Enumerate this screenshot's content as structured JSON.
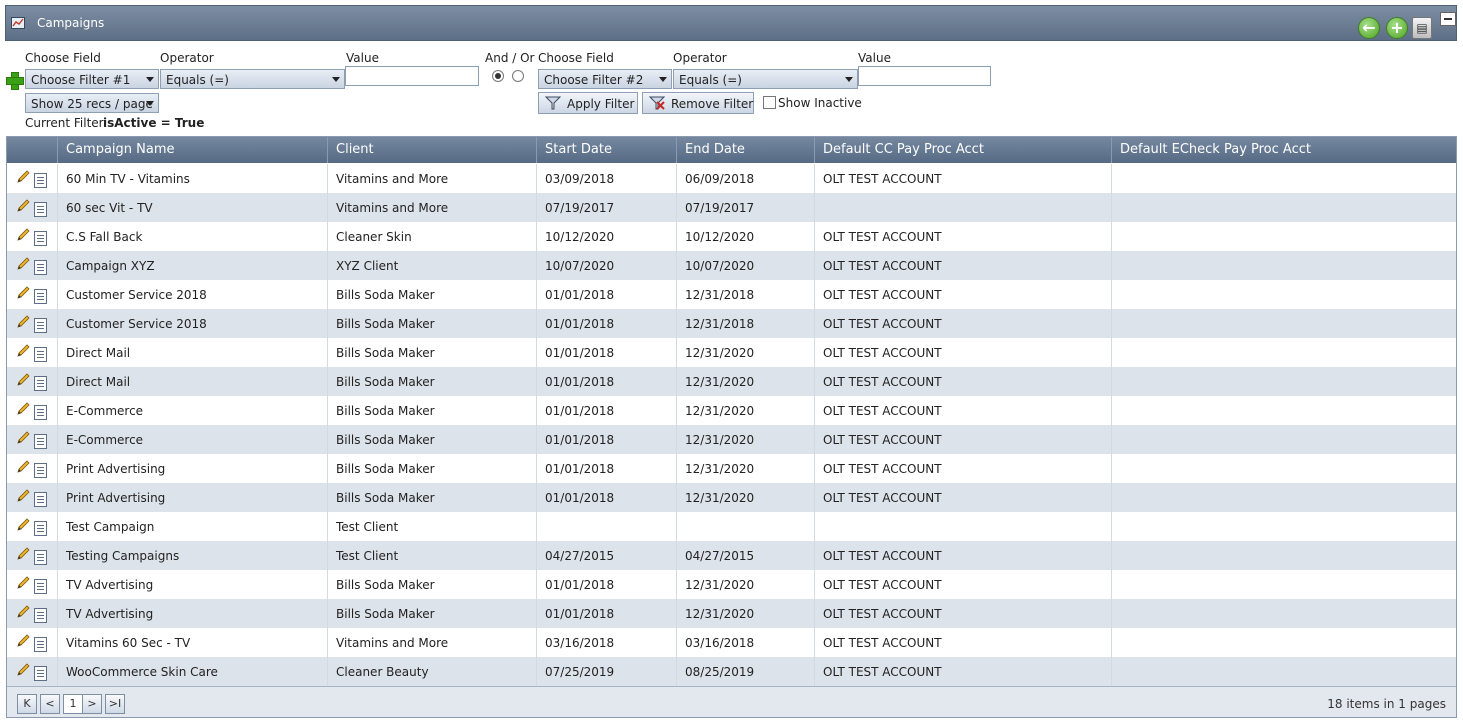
{
  "window": {
    "title": "Campaigns"
  },
  "toolbar_icons": [
    "back-arrow-icon",
    "add-icon",
    "export-icon",
    "collapse-icon"
  ],
  "filter": {
    "choose_field_label": "Choose Field",
    "operator_label": "Operator",
    "value_label": "Value",
    "and_or_label": "And / Or",
    "filter1": {
      "field": "Choose Filter #1",
      "operator": "Equals (=)",
      "value": ""
    },
    "filter2": {
      "field": "Choose Filter #2",
      "operator": "Equals (=)",
      "value": ""
    },
    "page_size": "Show 25 recs / page",
    "apply_label": "Apply Filter",
    "remove_label": "Remove Filter",
    "show_inactive_label": "Show Inactive",
    "current_filter_label": "Current Filter:",
    "current_filter_value": "isActive = True"
  },
  "table": {
    "columns": [
      "Campaign Name",
      "Client",
      "Start Date",
      "End Date",
      "Default CC Pay Proc Acct",
      "Default ECheck Pay Proc Acct"
    ],
    "rows": [
      [
        "60 Min TV - Vitamins",
        "Vitamins and More",
        "03/09/2018",
        "06/09/2018",
        "OLT TEST ACCOUNT",
        ""
      ],
      [
        "60 sec Vit - TV",
        "Vitamins and More",
        "07/19/2017",
        "07/19/2017",
        "",
        ""
      ],
      [
        "C.S Fall Back",
        "Cleaner Skin",
        "10/12/2020",
        "10/12/2020",
        "OLT TEST ACCOUNT",
        ""
      ],
      [
        "Campaign XYZ",
        "XYZ Client",
        "10/07/2020",
        "10/07/2020",
        "OLT TEST ACCOUNT",
        ""
      ],
      [
        "Customer Service 2018",
        "Bills Soda Maker",
        "01/01/2018",
        "12/31/2018",
        "OLT TEST ACCOUNT",
        ""
      ],
      [
        "Customer Service 2018",
        "Bills Soda Maker",
        "01/01/2018",
        "12/31/2018",
        "OLT TEST ACCOUNT",
        ""
      ],
      [
        "Direct Mail",
        "Bills Soda Maker",
        "01/01/2018",
        "12/31/2020",
        "OLT TEST ACCOUNT",
        ""
      ],
      [
        "Direct Mail",
        "Bills Soda Maker",
        "01/01/2018",
        "12/31/2020",
        "OLT TEST ACCOUNT",
        ""
      ],
      [
        "E-Commerce",
        "Bills Soda Maker",
        "01/01/2018",
        "12/31/2020",
        "OLT TEST ACCOUNT",
        ""
      ],
      [
        "E-Commerce",
        "Bills Soda Maker",
        "01/01/2018",
        "12/31/2020",
        "OLT TEST ACCOUNT",
        ""
      ],
      [
        "Print Advertising",
        "Bills Soda Maker",
        "01/01/2018",
        "12/31/2020",
        "OLT TEST ACCOUNT",
        ""
      ],
      [
        "Print Advertising",
        "Bills Soda Maker",
        "01/01/2018",
        "12/31/2020",
        "OLT TEST ACCOUNT",
        ""
      ],
      [
        "Test Campaign",
        "Test Client",
        "",
        "",
        "",
        ""
      ],
      [
        "Testing Campaigns",
        "Test Client",
        "04/27/2015",
        "04/27/2015",
        "OLT TEST ACCOUNT",
        ""
      ],
      [
        "TV Advertising",
        "Bills Soda Maker",
        "01/01/2018",
        "12/31/2020",
        "OLT TEST ACCOUNT",
        ""
      ],
      [
        "TV Advertising",
        "Bills Soda Maker",
        "01/01/2018",
        "12/31/2020",
        "OLT TEST ACCOUNT",
        ""
      ],
      [
        "Vitamins 60 Sec - TV",
        "Vitamins and More",
        "03/16/2018",
        "03/16/2018",
        "OLT TEST ACCOUNT",
        ""
      ],
      [
        "WooCommerce Skin Care",
        "Cleaner Beauty",
        "07/25/2019",
        "08/25/2019",
        "OLT TEST ACCOUNT",
        ""
      ]
    ]
  },
  "pager": {
    "first": "K",
    "prev": "<",
    "current_page": "1",
    "next": ">",
    "last": ">I",
    "items_count": "18",
    "items_text_mid": "items in",
    "pages_count": "1",
    "pages_text": "pages"
  },
  "colors": {
    "header": "#566a84",
    "alt_row": "#dde3ea",
    "accent_green": "#4ca321"
  }
}
